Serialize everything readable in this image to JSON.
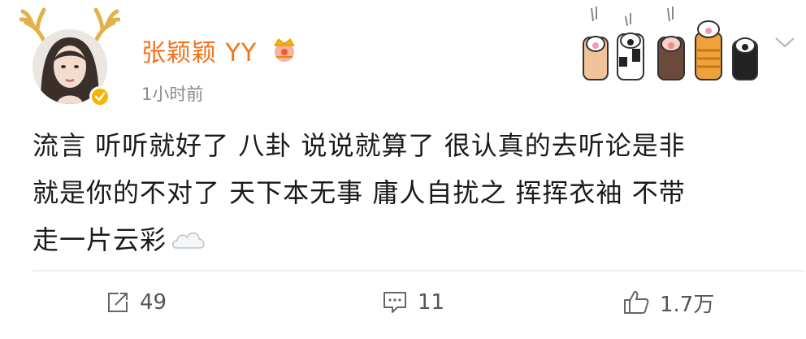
{
  "post": {
    "author": {
      "name": "张颖颖 YY"
    },
    "timestamp": "1小时前",
    "content_lines": [
      "流言 听听就好了 八卦 说说就算了 很认真的去听论是非",
      "就是你的不对了 天下本无事 庸人自扰之 挥挥衣袖 不带",
      "走一片云彩"
    ],
    "actions": {
      "repost_count": "49",
      "comment_count": "11",
      "like_count": "1.7万"
    }
  },
  "colors": {
    "username": "#f2731b",
    "verified_badge": "#f5b400",
    "meta_text": "#8a8a8a",
    "action_text": "#555555"
  },
  "icons": {
    "antlers": "antler-icon",
    "verified": "verified-badge-icon",
    "crown": "crown-icon",
    "paws": "cat-paw-decoration",
    "expand": "chevron-down-icon",
    "cloud": "cloud-emoji",
    "repost": "repost-icon",
    "comment": "comment-icon",
    "like": "thumbs-up-icon"
  }
}
